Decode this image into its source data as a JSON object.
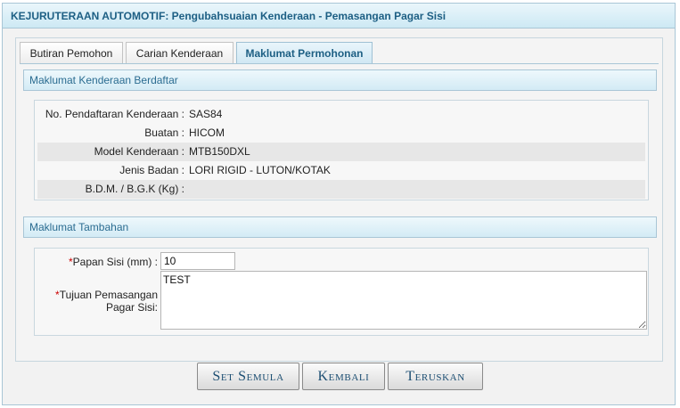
{
  "header": {
    "title": "KEJURUTERAAN AUTOMOTIF: Pengubahsuaian Kenderaan - Pemasangan Pagar Sisi"
  },
  "tabs": [
    {
      "label": "Butiran Pemohon",
      "active": false
    },
    {
      "label": "Carian Kenderaan",
      "active": false
    },
    {
      "label": "Maklumat Permohonan",
      "active": true
    }
  ],
  "registered_vehicle": {
    "section_title": "Maklumat Kenderaan Berdaftar",
    "fields": [
      {
        "label": "No. Pendaftaran Kenderaan :",
        "value": "SAS84"
      },
      {
        "label": "Buatan :",
        "value": "HICOM"
      },
      {
        "label": "Model Kenderaan :",
        "value": "MTB150DXL"
      },
      {
        "label": "Jenis Badan :",
        "value": "LORI RIGID - LUTON/KOTAK"
      },
      {
        "label": "B.D.M. / B.G.K (Kg) :",
        "value": ""
      }
    ]
  },
  "additional_info": {
    "section_title": "Maklumat Tambahan",
    "required_mark": "*",
    "panel_width": {
      "label": "Papan Sisi (mm) :",
      "value": "10"
    },
    "purpose": {
      "label_line1": "Tujuan Pemasangan",
      "label_line2": "Pagar Sisi:",
      "value": "TEST"
    }
  },
  "buttons": {
    "reset": "Set Semula",
    "back": "Kembali",
    "continue": "Teruskan"
  },
  "colors": {
    "accent": "#1d5f84",
    "required": "#cc0000"
  }
}
